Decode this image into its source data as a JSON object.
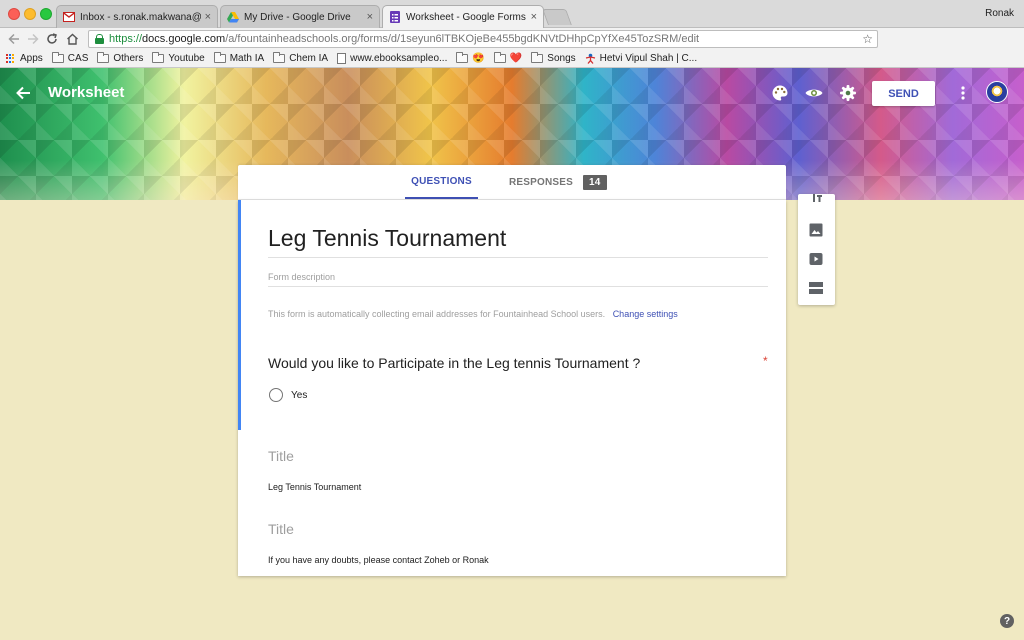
{
  "browser": {
    "tabs": [
      {
        "label": "Inbox - s.ronak.makwana@fou"
      },
      {
        "label": "My Drive - Google Drive"
      },
      {
        "label": "Worksheet - Google Forms"
      }
    ],
    "close_glyph": "×",
    "profile_name": "Ronak",
    "url": {
      "scheme": "https://",
      "host": "docs.google.com",
      "path": "/a/fountainheadschools.org/forms/d/1seyun6lTBKOjeBe455bgdKNVtDHhpCpYfXe45TozSRM/edit"
    },
    "bookmarks": [
      {
        "label": "Apps",
        "icon": "apps-icon"
      },
      {
        "label": "CAS",
        "icon": "folder-icon"
      },
      {
        "label": "Others",
        "icon": "folder-icon"
      },
      {
        "label": "Youtube",
        "icon": "folder-icon"
      },
      {
        "label": "Math IA",
        "icon": "folder-icon"
      },
      {
        "label": "Chem IA",
        "icon": "folder-icon"
      },
      {
        "label": "www.ebooksampleo...",
        "icon": "page-icon"
      },
      {
        "label": "😍",
        "icon": "folder-icon"
      },
      {
        "label": "❤️",
        "icon": "folder-icon"
      },
      {
        "label": "Songs",
        "icon": "folder-icon"
      },
      {
        "label": "Hetvi Vipul Shah | C...",
        "icon": "person-icon"
      }
    ]
  },
  "header": {
    "form_name": "Worksheet",
    "send_label": "SEND",
    "colors": {
      "accent": "#3f51b5"
    }
  },
  "tabs": {
    "questions_label": "QUESTIONS",
    "responses_label": "RESPONSES",
    "responses_count": "14"
  },
  "form": {
    "title": "Leg Tennis Tournament",
    "description_placeholder": "Form description",
    "email_notice": "This form is automatically collecting email addresses for Fountainhead School users.",
    "change_settings_label": "Change settings",
    "question": {
      "title": "Would you like to Participate in the Leg tennis Tournament ?",
      "required_mark": "*",
      "options": [
        "Yes"
      ]
    },
    "sections": [
      {
        "title": "Title",
        "description": "Leg Tennis Tournament"
      },
      {
        "title": "Title",
        "description": "If you have any doubts, please contact Zoheb or Ronak"
      }
    ]
  },
  "help_glyph": "?"
}
